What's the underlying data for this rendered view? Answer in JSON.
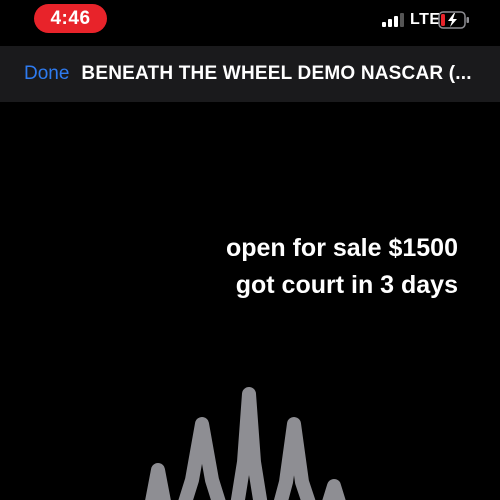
{
  "status_bar": {
    "time": "4:46",
    "network": "LTE",
    "icons": [
      "cellular-signal-icon",
      "battery-charging-icon"
    ],
    "time_pill_color": "#e8232a"
  },
  "nav": {
    "done_label": "Done",
    "title": "BENEATH THE WHEEL DEMO NASCAR (...",
    "accent_color": "#2e7bf0"
  },
  "caption": {
    "line1": "open for sale $1500",
    "line2": "got court in 3 days"
  },
  "waveform": {
    "color": "#8e8e93",
    "icon": "audio-waveform"
  }
}
